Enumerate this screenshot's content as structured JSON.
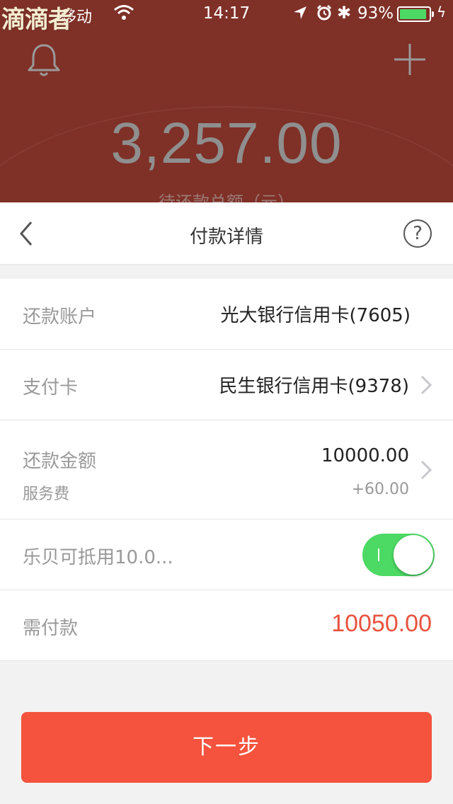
{
  "watermark": "滴滴者",
  "status_bar": {
    "carrier": "移动",
    "time": "14:17",
    "battery_percent": "93%",
    "battery_level": 0.93,
    "bluetooth_symbol": "✱",
    "bolt_symbol": "ϟ",
    "icons": [
      "wifi-icon",
      "location-arrow-icon",
      "alarm-icon",
      "bluetooth-icon",
      "battery-icon",
      "charging-bolt-icon"
    ]
  },
  "header": {
    "total_amount": "3,257.00",
    "total_label": "待还款总额（元）",
    "icons": [
      "bell-icon",
      "plus-icon"
    ]
  },
  "nav": {
    "title": "付款详情",
    "help_label": "?",
    "icons": [
      "back-chevron-icon",
      "help-icon"
    ]
  },
  "rows": {
    "repay_account": {
      "label": "还款账户",
      "value": "光大银行信用卡(7605)"
    },
    "pay_card": {
      "label": "支付卡",
      "value": "民生银行信用卡(9378)"
    },
    "repay_amount": {
      "label": "还款金额",
      "value": "10000.00",
      "sub_label": "服务费",
      "sub_value": "+60.00"
    },
    "lebei": {
      "label": "乐贝可抵用10.0...",
      "toggle_on": true
    },
    "need_pay": {
      "label": "需付款",
      "value": "10050.00"
    }
  },
  "colors": {
    "header_bg": "#7f3027",
    "toggle_on": "#4cd964",
    "accent": "#f5533d",
    "pay_value": "#e9533f"
  },
  "next_button": {
    "label": "下一步"
  }
}
